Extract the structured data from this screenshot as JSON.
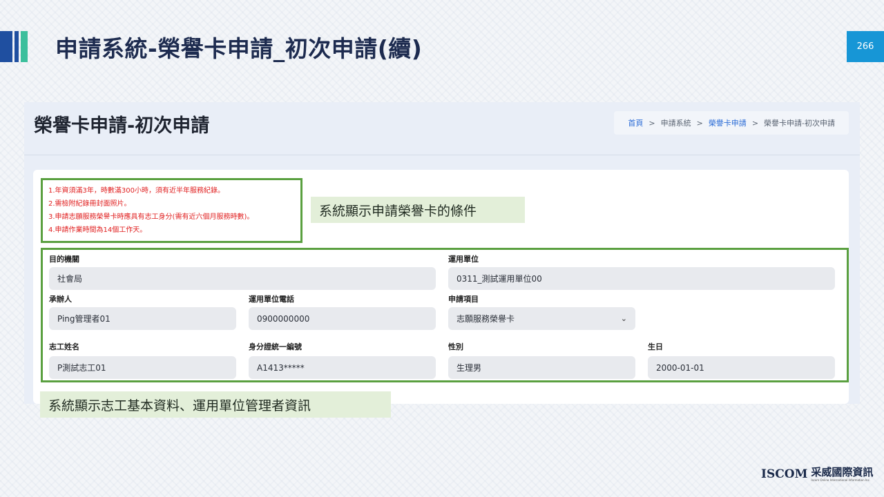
{
  "slide": {
    "title": "申請系統-榮譽卡申請_初次申請(續)",
    "page_number": "266",
    "accent_colors": [
      "#1f4fa0",
      "#3bbf9c",
      "#1796d6"
    ]
  },
  "app": {
    "page_title": "榮譽卡申請-初次申請",
    "breadcrumb": [
      {
        "label": "首頁",
        "link": true
      },
      {
        "label": "申請系統",
        "link": false
      },
      {
        "label": "榮譽卡申請",
        "link": true
      },
      {
        "label": "榮譽卡申請-初次申請",
        "link": false
      }
    ],
    "breadcrumb_separator": ">",
    "conditions": [
      "1.年資須滿3年，時數滿300小時，須有近半年服務紀錄。",
      "2.需檢附紀錄冊封面照片。",
      "3.申請志願服務榮譽卡時應具有志工身分(需有近六個月服務時數)。",
      "4.申請作業時間為14個工作天。"
    ],
    "form": {
      "agency": {
        "label": "目的機關",
        "value": "社會局"
      },
      "unit": {
        "label": "運用單位",
        "value": "0311_測試運用單位00"
      },
      "handler": {
        "label": "承辦人",
        "value": "Ping管理者01"
      },
      "unit_phone": {
        "label": "運用單位電話",
        "value": "0900000000"
      },
      "item": {
        "label": "申請項目",
        "value": "志願服務榮譽卡"
      },
      "volunteer_name": {
        "label": "志工姓名",
        "value": "P測試志工01"
      },
      "id_number": {
        "label": "身分證統一編號",
        "value": "A1413*****"
      },
      "gender": {
        "label": "性別",
        "value": "生理男"
      },
      "birthday": {
        "label": "生日",
        "value": "2000-01-01"
      }
    }
  },
  "annotations": {
    "conditions_note": "系統顯示申請榮譽卡的條件",
    "form_note": "系統顯示志工基本資料、運用單位管理者資訊"
  },
  "logo": {
    "en": "ISCOM",
    "zh": "采威國際資訊",
    "sub": "Iscom Online International Information Inc."
  },
  "icons": {
    "select_chevron": "chevron-down-icon"
  }
}
